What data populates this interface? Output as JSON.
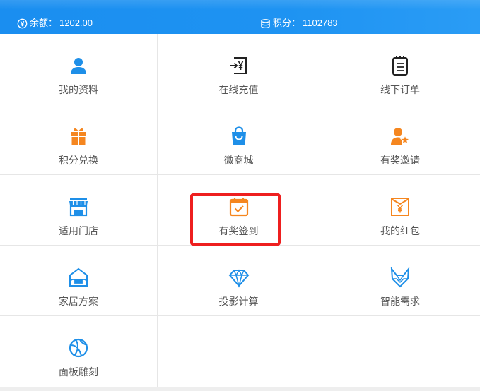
{
  "header": {
    "balance_label": "余额：",
    "balance_value": "1202.00",
    "points_label": "积分：",
    "points_value": "1102783",
    "balance_icon": "yen-circle-icon",
    "points_icon": "coins-stack-icon"
  },
  "grid": [
    {
      "label": "我的资料",
      "icon": "user-icon",
      "color": "#1e8fe8"
    },
    {
      "label": "在线充值",
      "icon": "recharge-yen-icon",
      "color": "#222222"
    },
    {
      "label": "线下订单",
      "icon": "order-list-icon",
      "color": "#222222"
    },
    {
      "label": "积分兑换",
      "icon": "gift-icon",
      "color": "#f5861f"
    },
    {
      "label": "微商城",
      "icon": "shopping-bag-icon",
      "color": "#1e8fe8"
    },
    {
      "label": "有奖邀请",
      "icon": "user-star-icon",
      "color": "#f5861f"
    },
    {
      "label": "适用门店",
      "icon": "store-icon",
      "color": "#1e8fe8"
    },
    {
      "label": "有奖签到",
      "icon": "calendar-check-icon",
      "color": "#f5861f"
    },
    {
      "label": "我的红包",
      "icon": "red-envelope-icon",
      "color": "#f5861f"
    },
    {
      "label": "家居方案",
      "icon": "home-sofa-icon",
      "color": "#1e8fe8"
    },
    {
      "label": "投影计算",
      "icon": "diamond-icon",
      "color": "#1e8fe8"
    },
    {
      "label": "智能需求",
      "icon": "fox-icon",
      "color": "#1e8fe8"
    },
    {
      "label": "面板雕刻",
      "icon": "basketball-icon",
      "color": "#1e8fe8"
    }
  ],
  "colors": {
    "header_bg": "#1e93f2",
    "highlight": "#ee1f1f"
  }
}
